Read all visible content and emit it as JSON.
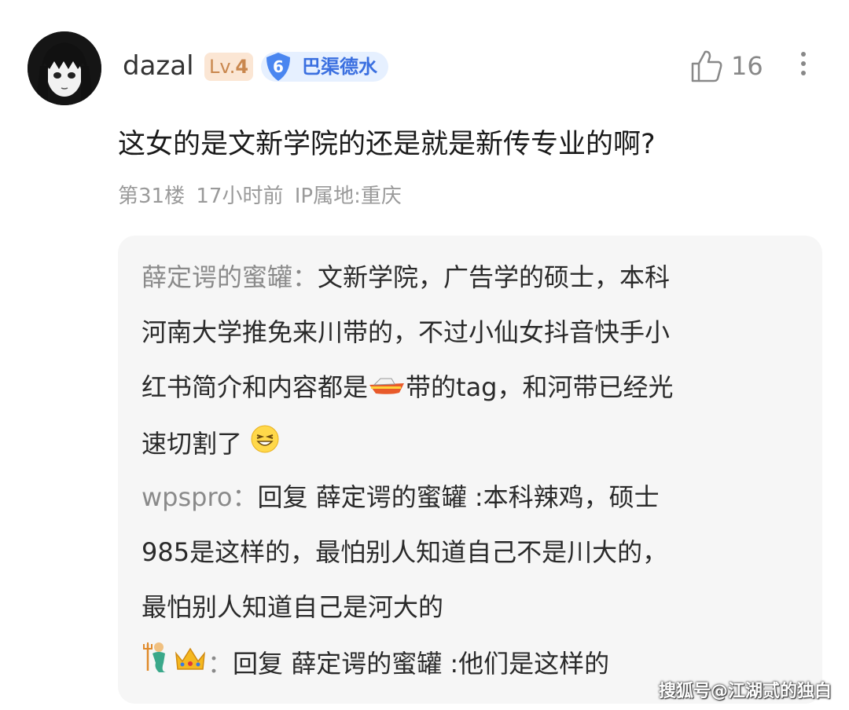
{
  "comment": {
    "username": "dazal",
    "level_prefix": "Lv.",
    "level_number": "4",
    "group_rank": "6",
    "group_name": "巴渠德水",
    "like_count": "16",
    "text": "这女的是文新学院的还是就是新传专业的啊?",
    "floor": "第31楼",
    "time": "17小时前",
    "ip": "IP属地:重庆"
  },
  "replies": [
    {
      "author": "薛定谔的蜜罐：",
      "text_part1": "文新学院，广告学的硕士，本科",
      "text_line2": "河南大学推免来川带的，不过小仙女抖音快手小",
      "text_line3a": "红书简介和内容都是",
      "emoji_boat": "boat-emoji",
      "text_line3b": "带的tag，和河带已经光",
      "text_line4": "速切割了",
      "emoji_face": "grinning-squint-emoji"
    },
    {
      "author": "wpspro：",
      "text_part1": "回复 薛定谔的蜜罐 :本科辣鸡，硕士",
      "text_line2": "985是这样的，最怕别人知道自己不是川大的，",
      "text_line3": "最怕别人知道自己是河大的"
    },
    {
      "author_emoji1": "merman-emoji",
      "author_emoji2": "crown-emoji",
      "author_suffix": "：",
      "text": "回复 薛定谔的蜜罐 :他们是这样的"
    }
  ],
  "watermark": "搜狐号@江湖贰的独白"
}
